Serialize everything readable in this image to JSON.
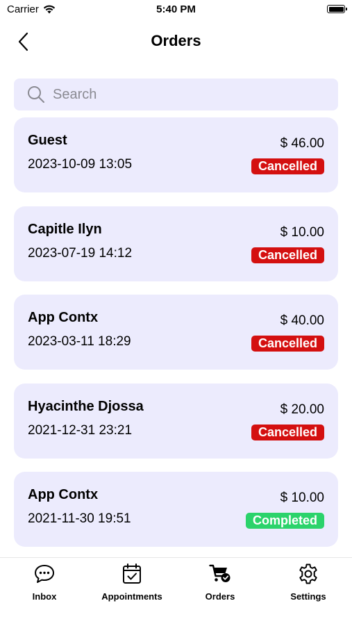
{
  "status_bar": {
    "carrier": "Carrier",
    "time": "5:40 PM"
  },
  "header": {
    "title": "Orders"
  },
  "search": {
    "placeholder": "Search"
  },
  "orders": [
    {
      "name": "Guest",
      "date": "2023-10-09 13:05",
      "amount": "$ 46.00",
      "status": "Cancelled"
    },
    {
      "name": "Capitle Ilyn",
      "date": "2023-07-19 14:12",
      "amount": "$ 10.00",
      "status": "Cancelled"
    },
    {
      "name": "App Contx",
      "date": "2023-03-11 18:29",
      "amount": "$ 40.00",
      "status": "Cancelled"
    },
    {
      "name": "Hyacinthe Djossa",
      "date": "2021-12-31 23:21",
      "amount": "$ 20.00",
      "status": "Cancelled"
    },
    {
      "name": "App Contx",
      "date": "2021-11-30 19:51",
      "amount": "$ 10.00",
      "status": "Completed"
    }
  ],
  "tabs": [
    {
      "label": "Inbox",
      "icon": "chat-bubble-icon"
    },
    {
      "label": "Appointments",
      "icon": "calendar-check-icon"
    },
    {
      "label": "Orders",
      "icon": "cart-check-icon"
    },
    {
      "label": "Settings",
      "icon": "gear-icon"
    }
  ],
  "colors": {
    "card_background": "#ecebfd",
    "cancelled": "#d41010",
    "completed": "#2bd36b"
  }
}
